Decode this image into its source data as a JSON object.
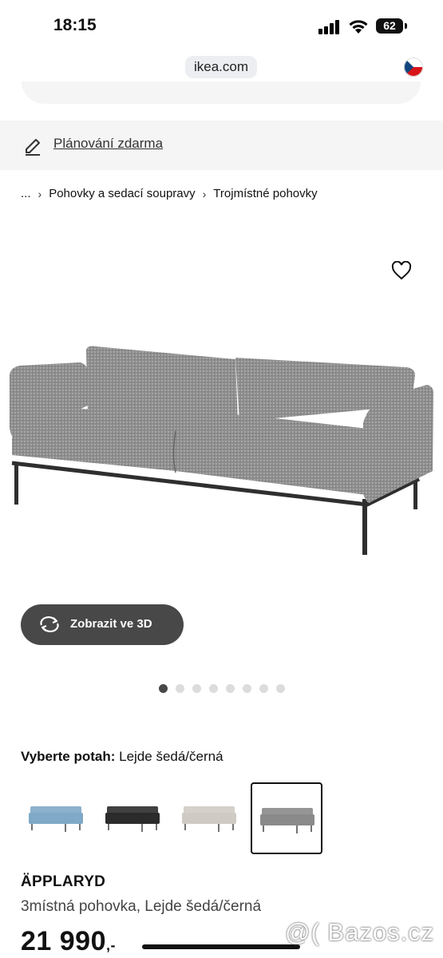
{
  "status_bar": {
    "time": "18:15",
    "battery": "62"
  },
  "browser": {
    "url": "ikea.com"
  },
  "planning": {
    "label": "Plánování zdarma"
  },
  "breadcrumb": {
    "ellipsis": "...",
    "items": [
      "Pohovky a sedací soupravy",
      "Trojmístné pohovky"
    ]
  },
  "product": {
    "view_3d_label": "Zobrazit ve 3D",
    "image_count": 8,
    "active_image": 1,
    "cover_label": "Vyberte potah:",
    "cover_value": "Lejde šedá/černá",
    "swatch_colors": [
      "#7fa9c6",
      "#2b2b2b",
      "#cfcbc4",
      "#8a8a8a"
    ],
    "selected_swatch": 4,
    "name": "ÄPPLARYD",
    "description": "3místná pohovka, Lejde šedá/černá",
    "price": "21 990",
    "price_suffix": ",-"
  },
  "watermark": "@( Bazos.cz"
}
